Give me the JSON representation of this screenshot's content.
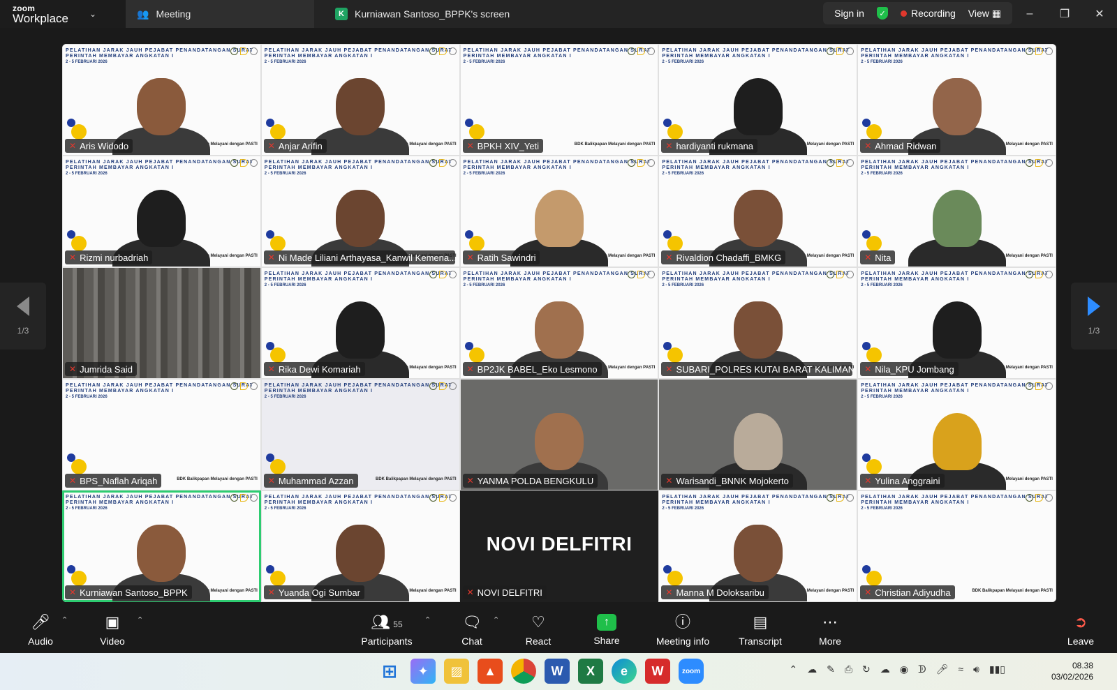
{
  "titlebar": {
    "brand_top": "zoom",
    "brand_bottom": "Workplace",
    "tab_meeting": "Meeting",
    "tab_screen": "Kurniawan Santoso_BPPK's screen",
    "screen_badge": "K",
    "sign_in": "Sign in",
    "recording": "Recording",
    "view": "View"
  },
  "slide": {
    "banner": "PELATIHAN JARAK JAUH PEJABAT PENANDATANGAN SURAT PERINTAH MEMBAYAR ANGKATAN I",
    "date": "2 - 5 FEBRUARI 2026",
    "footer": "BDK Balikpapan Melayani dengan PASTI"
  },
  "participants": [
    {
      "name": "Aris Widodo"
    },
    {
      "name": "Anjar Arifin"
    },
    {
      "name": "BPKH XIV_Yeti"
    },
    {
      "name": "hardiyanti rukmana"
    },
    {
      "name": "Ahmad Ridwan"
    },
    {
      "name": "Rizmi nurbadriah"
    },
    {
      "name": "Ni Made Liliani Arthayasa_Kanwil Kemena..."
    },
    {
      "name": "Ratih Sawindri"
    },
    {
      "name": "Rivaldion Chadaffi_BMKG"
    },
    {
      "name": "Nita"
    },
    {
      "name": "Jumrida Said"
    },
    {
      "name": "Rika Dewi Komariah"
    },
    {
      "name": "BP2JK BABEL_Eko Lesmono"
    },
    {
      "name": "SUBARI_POLRES KUTAI BARAT KALIMANT..."
    },
    {
      "name": "Nila_KPU Jombang"
    },
    {
      "name": "BPS_Naflah Ariqah"
    },
    {
      "name": "Muhammad Azzan"
    },
    {
      "name": "YANMA POLDA BENGKULU"
    },
    {
      "name": "Warisandi_BNNK Mojokerto"
    },
    {
      "name": "Yulina Anggraini"
    },
    {
      "name": "Kurniawan Santoso_BPPK"
    },
    {
      "name": "Yuanda Ogi Sumbar"
    },
    {
      "name": "NOVI DELFITRI",
      "big": "NOVI DELFITRI"
    },
    {
      "name": "Manna M Doloksaribu"
    },
    {
      "name": "Christian Adiyudha"
    }
  ],
  "pager": {
    "left": "1/3",
    "right": "1/3"
  },
  "toolbar": {
    "audio": "Audio",
    "video": "Video",
    "participants": "Participants",
    "participants_count": "55",
    "chat": "Chat",
    "react": "React",
    "share": "Share",
    "meeting_info": "Meeting info",
    "transcript": "Transcript",
    "more": "More",
    "leave": "Leave"
  },
  "taskbar": {
    "time": "08.38",
    "date": "03/02/2026"
  }
}
